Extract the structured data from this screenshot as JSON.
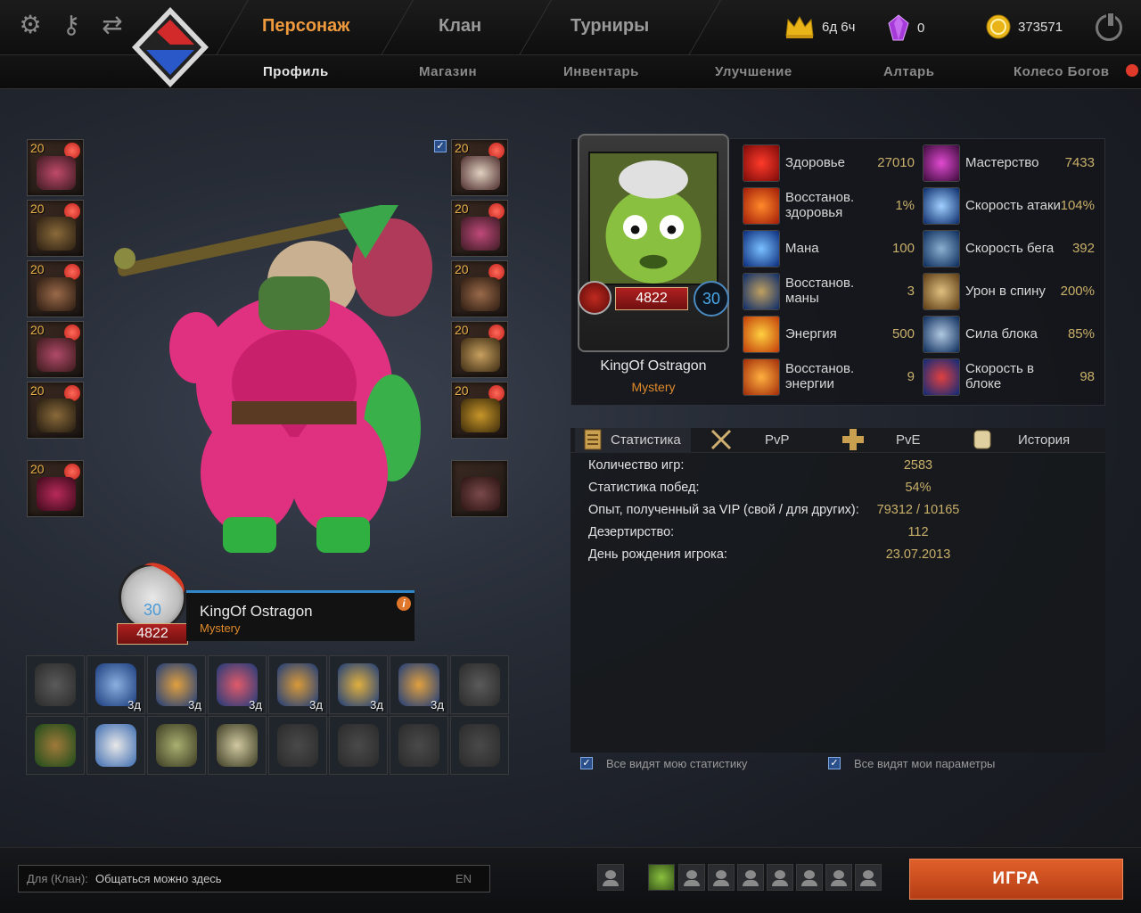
{
  "header": {
    "main_tabs": [
      {
        "label": "Персонаж",
        "active": true
      },
      {
        "label": "Клан",
        "active": false
      },
      {
        "label": "Турниры",
        "active": false
      }
    ],
    "sub_tabs": [
      {
        "label": "Профиль",
        "active": true
      },
      {
        "label": "Магазин",
        "active": false
      },
      {
        "label": "Инвентарь",
        "active": false
      },
      {
        "label": "Улучшение",
        "active": false
      },
      {
        "label": "Алтарь",
        "active": false
      },
      {
        "label": "Колесо Богов",
        "active": false
      }
    ],
    "premium_time": "6д 6ч",
    "crystals": "0",
    "gold": "373571",
    "icons": [
      "gear-icon",
      "key-icon",
      "swap-icon",
      "crown-icon",
      "crystal-icon",
      "coin-icon",
      "power-icon"
    ],
    "accent_color": "#f09a3e"
  },
  "equipment": {
    "left_slots": [
      "20",
      "20",
      "20",
      "20",
      "20",
      "20"
    ],
    "right_slots": [
      "20",
      "20",
      "20",
      "20",
      "20",
      ""
    ]
  },
  "character": {
    "name": "KingOf Ostragon",
    "clan": "Mystery",
    "level": "30",
    "rating": "4822",
    "info_symbol": "i"
  },
  "talents": {
    "row1": [
      "",
      "3д",
      "3д",
      "3д",
      "3д",
      "3д",
      "3д",
      ""
    ],
    "row2": [
      "",
      "",
      "",
      "",
      "",
      "",
      "",
      ""
    ]
  },
  "stats": {
    "left": [
      {
        "name": "Здоровье",
        "value": "27010"
      },
      {
        "name": "Восстанов. здоровья",
        "value": "1%"
      },
      {
        "name": "Мана",
        "value": "100"
      },
      {
        "name": "Восстанов. маны",
        "value": "3"
      },
      {
        "name": "Энергия",
        "value": "500"
      },
      {
        "name": "Восстанов. энергии",
        "value": "9"
      }
    ],
    "right": [
      {
        "name": "Мастерство",
        "value": "7433"
      },
      {
        "name": "Скорость атаки",
        "value": "104%"
      },
      {
        "name": "Скорость бега",
        "value": "392"
      },
      {
        "name": "Урон в спину",
        "value": "200%"
      },
      {
        "name": "Сила блока",
        "value": "85%"
      },
      {
        "name": "Скорость в блоке",
        "value": "98"
      }
    ]
  },
  "profile_tabs": [
    {
      "label": "Статистика",
      "active": true
    },
    {
      "label": "PvP",
      "active": false
    },
    {
      "label": "PvE",
      "active": false
    },
    {
      "label": "История",
      "active": false
    }
  ],
  "profile_stats": [
    {
      "label": "Количество игр:",
      "value": "2583"
    },
    {
      "label": "Статистика побед:",
      "value": "54%"
    },
    {
      "label": "Опыт, полученный за VIP (свой / для других):",
      "value": "79312 / 10165"
    },
    {
      "label": "Дезертирство:",
      "value": "112"
    },
    {
      "label": "День рождения игрока:",
      "value": "23.07.2013"
    }
  ],
  "checkboxes": [
    {
      "label": "Все видят мою статистику",
      "checked": true
    },
    {
      "label": "Все видят мои параметры",
      "checked": true
    }
  ],
  "chat": {
    "prefix": "Для (Клан):",
    "placeholder": "Общаться можно здесь",
    "lang": "EN"
  },
  "play_button": "ИГРА"
}
